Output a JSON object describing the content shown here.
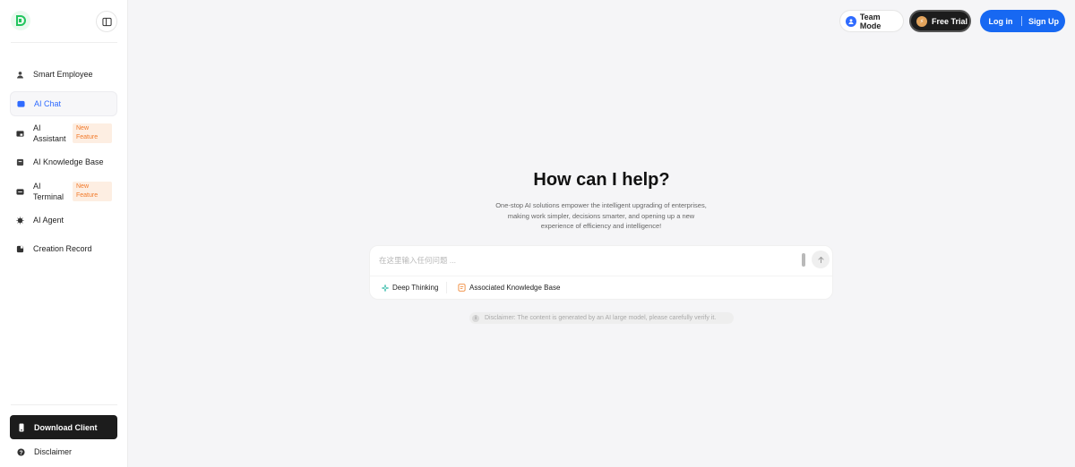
{
  "sidebar": {
    "items": [
      {
        "label": "Smart Employee",
        "icon": "person-icon"
      },
      {
        "label": "AI Chat",
        "icon": "chat-icon",
        "active": true
      },
      {
        "label": "AI Assistant",
        "icon": "assistant-icon",
        "badge": "New Feature"
      },
      {
        "label": "AI Knowledge Base",
        "icon": "book-icon"
      },
      {
        "label": "AI Terminal",
        "icon": "terminal-icon",
        "badge": "New Feature"
      },
      {
        "label": "AI Agent",
        "icon": "agent-icon"
      },
      {
        "label": "Creation Record",
        "icon": "record-icon"
      }
    ],
    "download_label": "Download Client",
    "disclaimer_label": "Disclaimer"
  },
  "header": {
    "team_mode": "Team Mode",
    "free_trial": "Free Trial",
    "login": "Log in",
    "signup": "Sign Up"
  },
  "main": {
    "title": "How can I help?",
    "subtitle": "One-stop AI solutions empower the intelligent upgrading of enterprises, making work simpler, decisions smarter, and opening up a new experience of efficiency and intelligence!",
    "input_placeholder": "在这里输入任何问题 ...",
    "options": {
      "deep_thinking": "Deep Thinking",
      "knowledge_base": "Associated Knowledge Base"
    },
    "notice": "Disclaimer: The content is generated by an AI large model, please carefully verify it."
  },
  "colors": {
    "accent": "#1768f2",
    "active_text": "#2f6bff",
    "badge_bg": "#fdeee2",
    "badge_text": "#f27a2b",
    "brand_green": "#22c55e"
  }
}
